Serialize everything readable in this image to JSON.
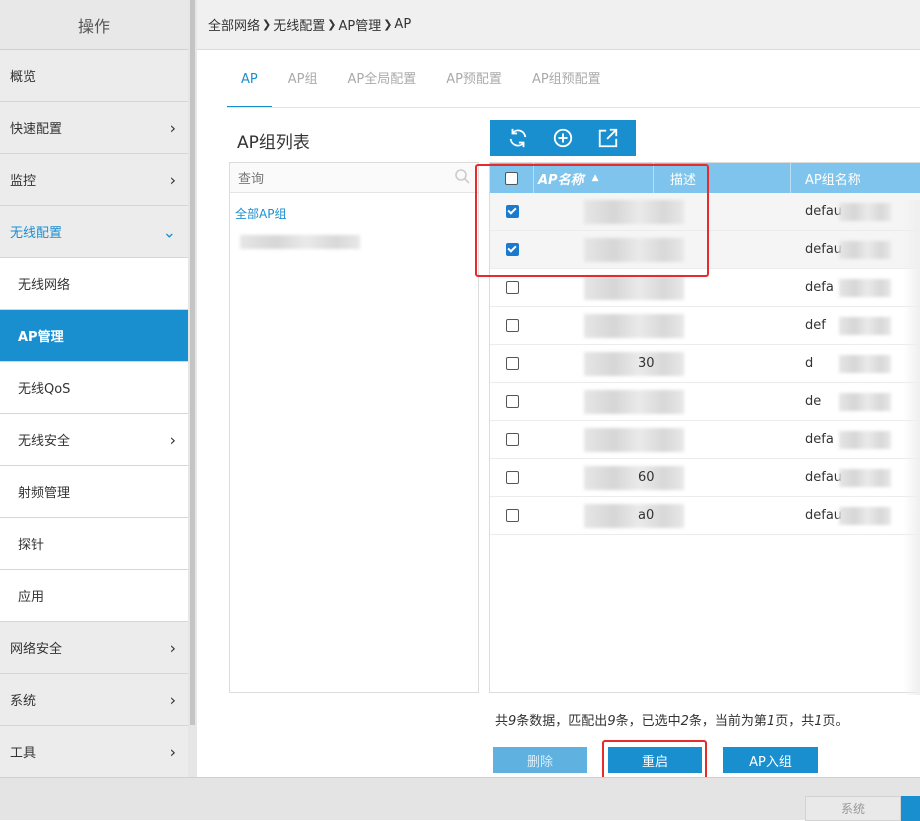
{
  "sidebar": {
    "header": "操作",
    "items": [
      {
        "label": "概览",
        "chevron": ""
      },
      {
        "label": "快速配置",
        "chevron": "›"
      },
      {
        "label": "监控",
        "chevron": "›"
      },
      {
        "label": "无线配置",
        "chevron": "⌄"
      },
      {
        "label": "无线网络",
        "chevron": ""
      },
      {
        "label": "AP管理",
        "chevron": ""
      },
      {
        "label": "无线QoS",
        "chevron": ""
      },
      {
        "label": "无线安全",
        "chevron": "›"
      },
      {
        "label": "射频管理",
        "chevron": ""
      },
      {
        "label": "探针",
        "chevron": ""
      },
      {
        "label": "应用",
        "chevron": ""
      },
      {
        "label": "网络安全",
        "chevron": "›"
      },
      {
        "label": "系统",
        "chevron": "›"
      },
      {
        "label": "工具",
        "chevron": "›"
      }
    ]
  },
  "breadcrumb": [
    "全部网络",
    "无线配置",
    "AP管理",
    "AP"
  ],
  "tabs": [
    "AP",
    "AP组",
    "AP全局配置",
    "AP预配置",
    "AP组预配置"
  ],
  "group_panel": {
    "title": "AP组列表",
    "search_placeholder": "查询",
    "root_label": "全部AP组"
  },
  "table": {
    "headers": {
      "name": "AP名称",
      "desc": "描述",
      "group": "AP组名称"
    },
    "rows": [
      {
        "checked": true,
        "name_suffix": "",
        "group": "defau"
      },
      {
        "checked": true,
        "name_suffix": "",
        "group": "defau"
      },
      {
        "checked": false,
        "name_suffix": "",
        "group": "defa"
      },
      {
        "checked": false,
        "name_suffix": "",
        "group": "def"
      },
      {
        "checked": false,
        "name_suffix": "30",
        "group": "d"
      },
      {
        "checked": false,
        "name_suffix": "",
        "group": "de"
      },
      {
        "checked": false,
        "name_suffix": "",
        "group": "defa"
      },
      {
        "checked": false,
        "name_suffix": "60",
        "group": "defau"
      },
      {
        "checked": false,
        "name_suffix": "a0",
        "group": "defaul"
      }
    ]
  },
  "summary": {
    "p1": "共",
    "total": "9",
    "p2": "条数据，匹配出",
    "matched": "9",
    "p3": "条，已选中",
    "selected": "2",
    "p4": "条，当前为第",
    "page": "1",
    "p5": "页，共",
    "pages": "1",
    "p6": "页。"
  },
  "buttons": {
    "delete": "删除",
    "restart": "重启",
    "join": "AP入组"
  },
  "footer": {
    "system": "系统"
  },
  "colors": {
    "accent": "#1a8fd0",
    "highlight": "#e52b2b"
  }
}
